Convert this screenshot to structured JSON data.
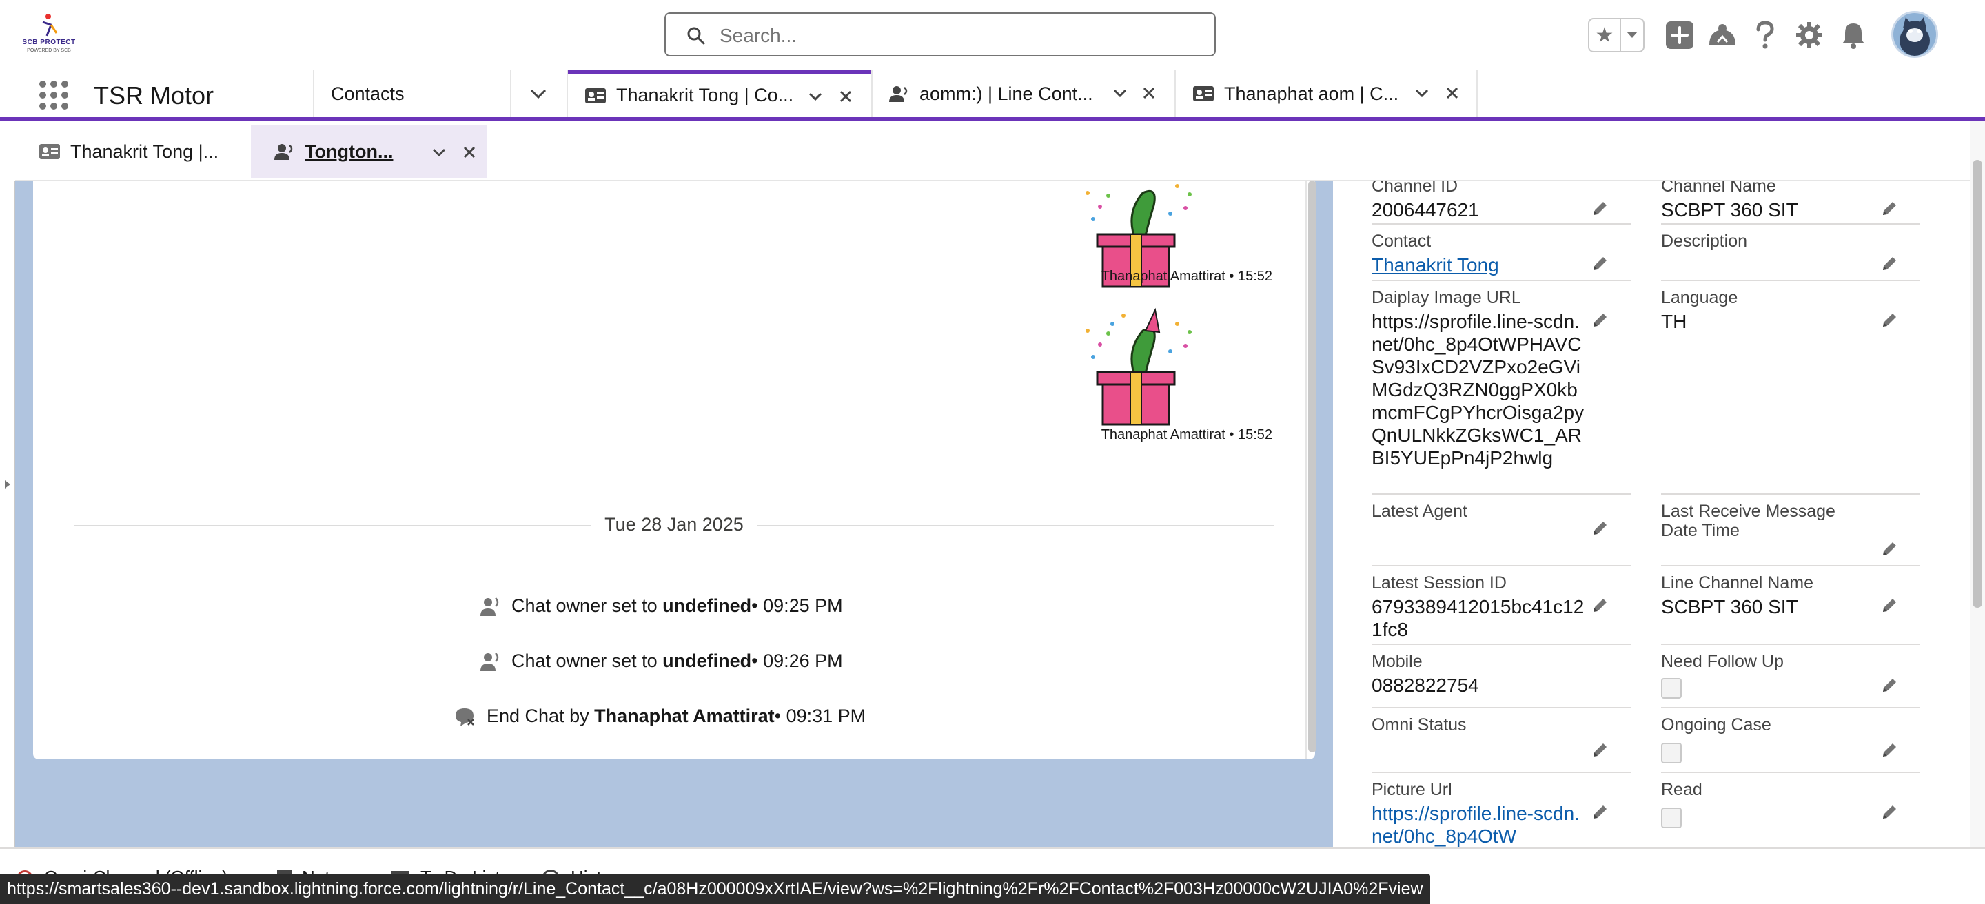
{
  "brand": {
    "logo_title": "SCB PROTECT",
    "logo_subtitle": "POWERED BY SCB"
  },
  "search": {
    "placeholder": "Search..."
  },
  "header_icons": [
    "favorites-star-icon",
    "favorites-dropdown-icon",
    "global-actions-plus-icon",
    "trailhead-icon",
    "help-icon",
    "setup-gear-icon",
    "notifications-bell-icon",
    "user-avatar"
  ],
  "nav": {
    "app_name": "TSR Motor",
    "object_item": "Contacts",
    "tabs": [
      {
        "label": "Thanakrit Tong | Co...",
        "icon": "contact-card-icon",
        "active": true
      },
      {
        "label": "aomm:) | Line Cont...",
        "icon": "line-contact-person-icon",
        "active": false
      },
      {
        "label": "Thanaphat aom | C...",
        "icon": "contact-card-icon",
        "active": false
      }
    ]
  },
  "subtabs": [
    {
      "label": "Thanakrit Tong |...",
      "icon": "contact-card-icon",
      "active": false
    },
    {
      "label": "Tongton...",
      "icon": "line-contact-person-icon",
      "active": true
    }
  ],
  "chat": {
    "messages": [
      {
        "sender": "Thanaphat Amattirat",
        "time": "15:52",
        "caption": "Thanaphat Amattirat • 15:52",
        "content": "gift-box-sticker"
      },
      {
        "sender": "Thanaphat Amattirat",
        "time": "15:52",
        "caption": "Thanaphat Amattirat • 15:52",
        "content": "gift-box-sticker"
      }
    ],
    "date_separator": "Tue 28 Jan 2025",
    "events": [
      {
        "pre": "Chat owner set to ",
        "bold": "undefined",
        "post": " • 09:25 PM",
        "icon": "chat-owner-icon"
      },
      {
        "pre": "Chat owner set to ",
        "bold": "undefined",
        "post": " • 09:26 PM",
        "icon": "chat-owner-icon"
      },
      {
        "pre": "End Chat by ",
        "bold": "Thanaphat Amattirat",
        "post": " • 09:31 PM",
        "icon": "end-chat-icon"
      }
    ]
  },
  "details": {
    "channel_id": {
      "label": "Channel ID",
      "value": "2006447621"
    },
    "channel_name": {
      "label": "Channel Name",
      "value": "SCBPT 360 SIT"
    },
    "contact": {
      "label": "Contact",
      "value": "Thanakrit Tong"
    },
    "description": {
      "label": "Description",
      "value": ""
    },
    "display_image_url": {
      "label": "Daiplay Image URL",
      "value": "https://sprofile.line-scdn.net/0hc_8p4OtWPHAVCSv93IxCD2VZPxo2eGViMGdzQ3RZN0ggPX0kbmcmFCgPYhcrOisga2pyQnULNkkZGksWC1_ARBI5YUEpPn4jP2hwlg"
    },
    "language": {
      "label": "Language",
      "value": "TH"
    },
    "latest_agent": {
      "label": "Latest Agent",
      "value": ""
    },
    "last_receive": {
      "label": "Last Receive Message Date Time",
      "value": ""
    },
    "latest_session_id": {
      "label": "Latest Session ID",
      "value": "6793389412015bc41c121fc8"
    },
    "line_channel_name": {
      "label": "Line Channel Name",
      "value": "SCBPT 360 SIT"
    },
    "mobile": {
      "label": "Mobile",
      "value": "0882822754"
    },
    "need_follow_up": {
      "label": "Need Follow Up",
      "checked": false
    },
    "omni_status": {
      "label": "Omni Status",
      "value": ""
    },
    "ongoing_case": {
      "label": "Ongoing Case",
      "checked": false
    },
    "picture_url": {
      "label": "Picture Url",
      "value": "https://sprofile.line-scdn.net/0hc_8p4OtW"
    },
    "read": {
      "label": "Read",
      "checked": false
    }
  },
  "footer": {
    "items": [
      "Omni-Channel (Offline)",
      "Notes",
      "To Do List",
      "History"
    ]
  },
  "status_url": "https://smartsales360--dev1.sandbox.lightning.force.com/lightning/r/Line_Contact__c/a08Hz000009xXrtIAE/view?ws=%2Flightning%2Fr%2FContact%2F003Hz00000cW2UJIA0%2Fview",
  "colors": {
    "accent": "#6b34b9",
    "link": "#0b5cab",
    "background": "#b0c4df"
  }
}
